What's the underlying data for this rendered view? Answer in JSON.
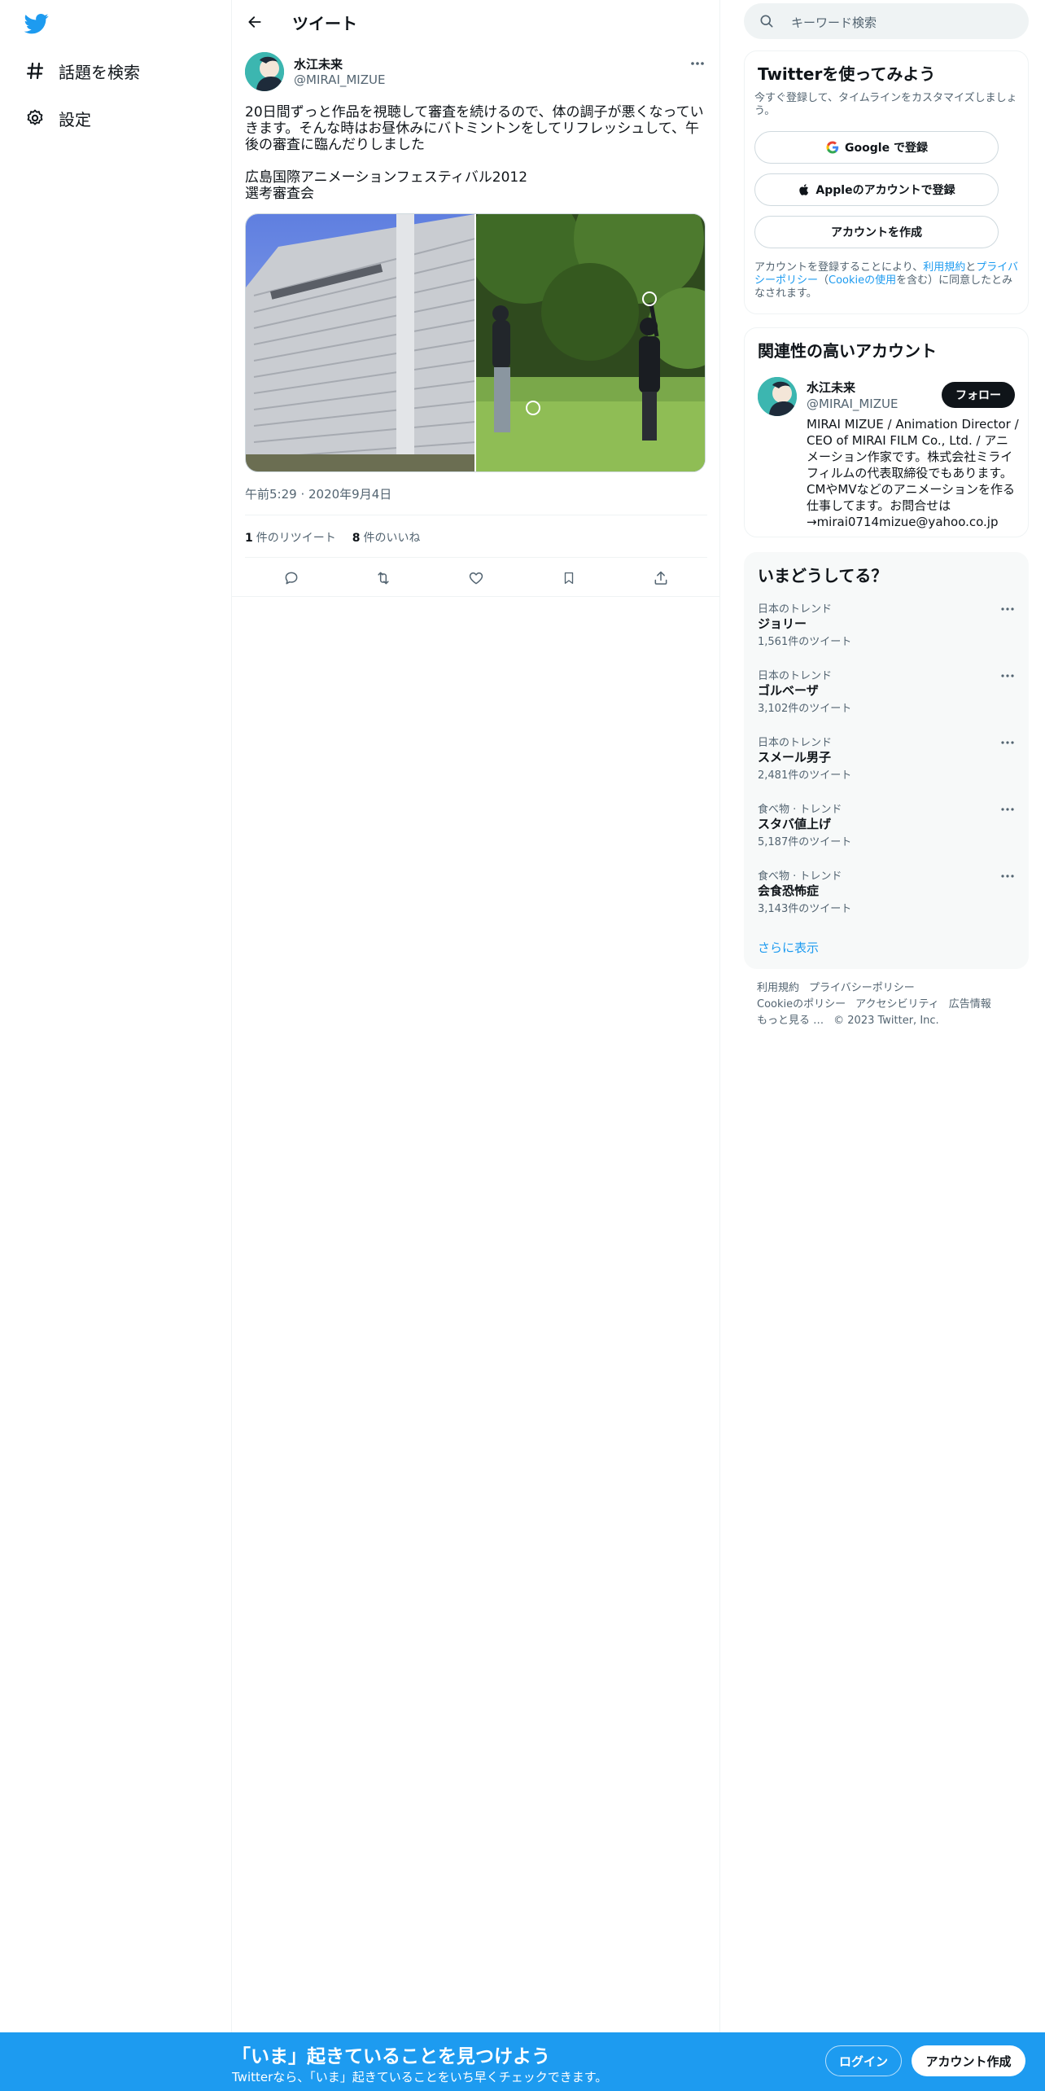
{
  "colors": {
    "accent": "#1d9bf0",
    "text": "#0f1419",
    "secondary": "#536471"
  },
  "nav": {
    "logo_icon": "twitter-bird-icon",
    "items": [
      {
        "label": "話題を検索",
        "icon": "hashtag-icon"
      },
      {
        "label": "設定",
        "icon": "gear-icon"
      }
    ]
  },
  "header": {
    "title": "ツイート"
  },
  "tweet": {
    "author_name": "水江未来",
    "author_handle": "@MIRAI_MIZUE",
    "text": "20日間ずっと作品を視聴して審査を続けるので、体の調子が悪くなってい\nきます。そんな時はお昼休みにバトミントンをしてリフレッシュして、午\n後の審査に臨んだりしました\n\n広島国際アニメーションフェスティバル2012\n選考審査会",
    "timestamp": "午前5:29 · 2020年9月4日",
    "retweets_count": "1",
    "retweets_label": "件のリツイート",
    "likes_count": "8",
    "likes_label": "件のいいね"
  },
  "search": {
    "placeholder": "キーワード検索"
  },
  "signup_card": {
    "title": "Twitterを使ってみよう",
    "desc": "今すぐ登録して、タイムラインをカスタマイズしましょう。",
    "google_label": "Google で登録",
    "apple_label": "Appleのアカウントで登録",
    "create_label": "アカウントを作成",
    "legal_prefix": "アカウントを登録することにより、",
    "legal_terms": "利用規約",
    "legal_and": "と",
    "legal_privacy": "プライバシーポリシー",
    "legal_paren_open": "（",
    "legal_cookie": "Cookieの使用",
    "legal_suffix": "を含む）に同意したとみなされます。"
  },
  "related_card": {
    "title": "関連性の高いアカウント",
    "name": "水江未来",
    "handle": "@MIRAI_MIZUE",
    "follow_label": "フォロー",
    "bio": "MIRAI MIZUE / Animation Director / CEO of MIRAI FILM Co., Ltd. / アニメーション作家です。株式会社ミライフィルムの代表取締役でもあります。CMやMVなどのアニメーションを作る仕事してます。お問合せは→mirai0714mizue@yahoo.co.jp"
  },
  "trends_card": {
    "title": "いまどうしてる？",
    "items": [
      {
        "category": "日本のトレンド",
        "name": "ジョリー",
        "count": "1,561件のツイート"
      },
      {
        "category": "日本のトレンド",
        "name": "ゴルベーザ",
        "count": "3,102件のツイート"
      },
      {
        "category": "日本のトレンド",
        "name": "スメール男子",
        "count": "2,481件のツイート"
      },
      {
        "category": "食べ物 · トレンド",
        "name": "スタバ値上げ",
        "count": "5,187件のツイート"
      },
      {
        "category": "食べ物 · トレンド",
        "name": "会食恐怖症",
        "count": "3,143件のツイート"
      }
    ],
    "show_more": "さらに表示"
  },
  "footer": {
    "terms": "利用規約",
    "privacy": "プライバシーポリシー",
    "cookie": "Cookieのポリシー",
    "accessibility": "アクセシビリティ",
    "ads": "広告情報",
    "more": "もっと見る …",
    "copyright": "© 2023 Twitter, Inc."
  },
  "bottom_bar": {
    "title": "「いま」起きていることを見つけよう",
    "subtitle": "Twitterなら、「いま」起きていることをいち早くチェックできます。",
    "login_label": "ログイン",
    "signup_label": "アカウント作成"
  }
}
